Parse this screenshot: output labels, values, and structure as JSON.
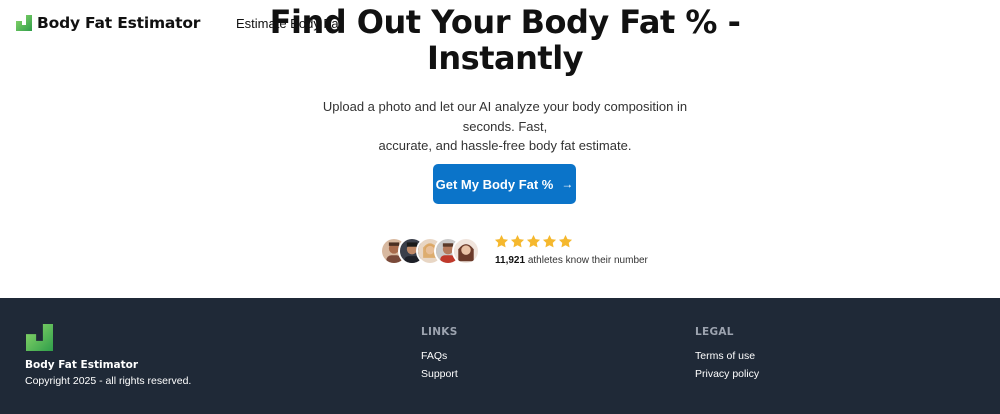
{
  "header": {
    "brand": "Body Fat Estimator",
    "nav_link": "Estimate Body Fat"
  },
  "hero": {
    "title_line1": "Find Out Your Body Fat % -",
    "title_line2": "Instantly",
    "subtitle_line1": "Upload a photo and let our AI analyze your body composition in seconds. Fast,",
    "subtitle_line2": "accurate, and hassle-free body fat estimate.",
    "cta_label": "Get My Body Fat %",
    "cta_arrow": "→"
  },
  "social_proof": {
    "rating_stars": 5,
    "count": "11,921",
    "caption": "athletes know their number"
  },
  "footer": {
    "brand": "Body Fat Estimator",
    "copyright": "Copyright 2025 - all rights reserved.",
    "links_title": "LINKS",
    "links": [
      "FAQs",
      "Support"
    ],
    "legal_title": "LEGAL",
    "legal": [
      "Terms of use",
      "Privacy policy"
    ]
  },
  "colors": {
    "accent": "#0b74c9",
    "footer_bg": "#1f2937",
    "star": "#f5b82e",
    "logo_green": "#4caf50"
  }
}
